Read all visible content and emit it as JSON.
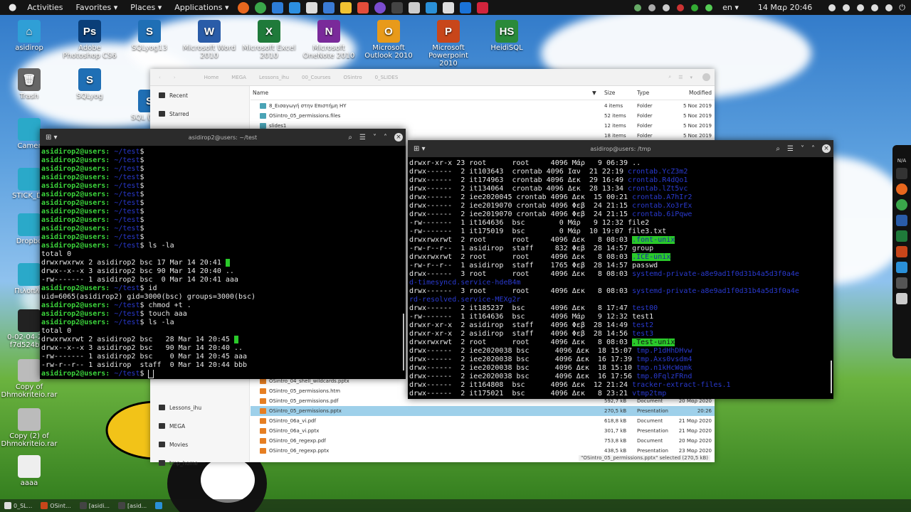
{
  "topbar": {
    "activities": "Activities",
    "favorites": "Favorites ▾",
    "places": "Places ▾",
    "applications": "Applications ▾",
    "language": "en ▾",
    "clock": "14 Μαρ 20:46"
  },
  "desktop_icons": [
    {
      "label": "asidirop",
      "color": "#2f9fd6",
      "glyph": "⌂"
    },
    {
      "label": "Adobe Photoshop CS6",
      "color": "#0a3e78",
      "glyph": "Ps"
    },
    {
      "label": "SQLyog13",
      "color": "#1f6fb5",
      "glyph": "S"
    },
    {
      "label": "Microsoft Word 2010",
      "color": "#2a5ca8",
      "glyph": "W"
    },
    {
      "label": "Microsoft Excel 2010",
      "color": "#1f7a3a",
      "glyph": "X"
    },
    {
      "label": "Microsoft OneNote 2010",
      "color": "#7a2a9a",
      "glyph": "N"
    },
    {
      "label": "Microsoft Outlook 2010",
      "color": "#e89a1a",
      "glyph": "O"
    },
    {
      "label": "Microsoft Powerpoint 2010",
      "color": "#c8461a",
      "glyph": "P"
    },
    {
      "label": "HeidiSQL",
      "color": "#2a8a3a",
      "glyph": "HS"
    },
    {
      "label": "Trash",
      "color": "#666",
      "glyph": "🗑"
    },
    {
      "label": "SQLyog",
      "color": "#1f6fb5",
      "glyph": "S"
    },
    {
      "label": "SQL (SQLy",
      "color": "#1f6fb5",
      "glyph": "S"
    },
    {
      "label": "Camer",
      "color": "#2aa9c9",
      "glyph": ""
    },
    {
      "label": "STICK_DE",
      "color": "#2aa9c9",
      "glyph": ""
    },
    {
      "label": "Dropbo",
      "color": "#2aa9c9",
      "glyph": ""
    },
    {
      "label": "Πιλοπλα",
      "color": "#2aa9c9",
      "glyph": ""
    },
    {
      "label": "0-02-04-288 f7d524b65",
      "color": "#222",
      "glyph": ""
    },
    {
      "label": "Copy of Dhmokriteio.rar",
      "color": "#bbb",
      "glyph": ""
    },
    {
      "label": "Copy (2) of Dhmokriteio.rar",
      "color": "#bbb",
      "glyph": ""
    },
    {
      "label": "aaaa",
      "color": "#eee",
      "glyph": ""
    }
  ],
  "file_manager": {
    "breadcrumb": [
      "Home",
      "MEGA",
      "Lessons_ihu",
      "00_Courses",
      "OSintro",
      "0_SLIDES"
    ],
    "sidebar": [
      "Recent",
      "Starred",
      "Lessons_ihu",
      "MEGA",
      "Movies",
      "tmp_home"
    ],
    "columns": {
      "name": "Name",
      "size": "Size",
      "type": "Type",
      "modified": "Modified"
    },
    "rows_top": [
      {
        "name": "8_Εισαγωγή στην Επιστήμη ΗΥ",
        "size": "4 items",
        "type": "Folder",
        "date": "5 Νοε 2019",
        "folder": true
      },
      {
        "name": "OSintro_05_permissions.files",
        "size": "52 items",
        "type": "Folder",
        "date": "5 Νοε 2019",
        "folder": true
      },
      {
        "name": "slides1",
        "size": "12 items",
        "type": "Folder",
        "date": "5 Νοε 2019",
        "folder": true
      },
      {
        "name": "",
        "size": "18 items",
        "type": "Folder",
        "date": "5 Νοε 2019",
        "folder": true
      }
    ],
    "rows_bottom": [
      {
        "name": "OSintro_04_shell_wildcards.pptx",
        "size": "",
        "type": "",
        "date": "",
        "folder": false
      },
      {
        "name": "OSintro_05_permissions.htm",
        "size": "",
        "type": "",
        "date": "",
        "folder": false
      },
      {
        "name": "OSintro_05_permissions.pdf",
        "size": "592,7 kB",
        "type": "Document",
        "date": "20 Μαρ 2020",
        "folder": false
      },
      {
        "name": "OSintro_05_permissions.pptx",
        "size": "270,5 kB",
        "type": "Presentation",
        "date": "20:26",
        "folder": false,
        "selected": true
      },
      {
        "name": "OSintro_06a_vi.pdf",
        "size": "618,8 kB",
        "type": "Document",
        "date": "21 Μαρ 2020",
        "folder": false
      },
      {
        "name": "OSintro_06a_vi.pptx",
        "size": "301,7 kB",
        "type": "Presentation",
        "date": "21 Μαρ 2020",
        "folder": false
      },
      {
        "name": "OSintro_06_regexp.pdf",
        "size": "753,8 kB",
        "type": "Document",
        "date": "20 Μαρ 2020",
        "folder": false
      },
      {
        "name": "OSintro_06_regexp.pptx",
        "size": "438,5 kB",
        "type": "Presentation",
        "date": "23 Μαρ 2020",
        "folder": false
      }
    ],
    "status": "\"OSintro_05_permissions.pptx\" selected  (270,5 kB)"
  },
  "term_left": {
    "title": "asidirop2@users: ~/test",
    "lines": [
      {
        "p": "asidirop2@users:",
        "path": " ~/test",
        "cmd": "$"
      },
      {
        "p": "asidirop2@users:",
        "path": " ~/test",
        "cmd": "$"
      },
      {
        "p": "asidirop2@users:",
        "path": " ~/test",
        "cmd": "$"
      },
      {
        "p": "asidirop2@users:",
        "path": " ~/test",
        "cmd": "$"
      },
      {
        "p": "asidirop2@users:",
        "path": " ~/test",
        "cmd": "$"
      },
      {
        "p": "asidirop2@users:",
        "path": " ~/test",
        "cmd": "$"
      },
      {
        "p": "asidirop2@users:",
        "path": " ~/test",
        "cmd": "$"
      },
      {
        "p": "asidirop2@users:",
        "path": " ~/test",
        "cmd": "$"
      },
      {
        "p": "asidirop2@users:",
        "path": " ~/test",
        "cmd": "$"
      },
      {
        "p": "asidirop2@users:",
        "path": " ~/test",
        "cmd": "$"
      },
      {
        "p": "asidirop2@users:",
        "path": " ~/test",
        "cmd": "$"
      },
      {
        "p": "asidirop2@users:",
        "path": " ~/test",
        "cmd": "$ ls -la"
      },
      {
        "t": "total 0"
      },
      {
        "t": "drwxrwxrwx 2 asidirop2 bsc 17 Mar 14 20:41 ",
        "box": true
      },
      {
        "t": "drwx--x--x 3 asidirop2 bsc 90 Mar 14 20:40 .."
      },
      {
        "t": "-rw------- 1 asidirop2 bsc  0 Mar 14 20:41 aaa"
      },
      {
        "p": "asidirop2@users:",
        "path": " ~/test",
        "cmd": "$ id"
      },
      {
        "t": "uid=6065(asidirop2) gid=3000(bsc) groups=3000(bsc)"
      },
      {
        "p": "asidirop2@users:",
        "path": " ~/test",
        "cmd": "$ chmod +t ."
      },
      {
        "p": "asidirop2@users:",
        "path": " ~/test",
        "cmd": "$ touch aaa"
      },
      {
        "p": "asidirop2@users:",
        "path": " ~/test",
        "cmd": "$ ls -la"
      },
      {
        "t": "total 0"
      },
      {
        "t": "drwxrwxrwt 2 asidirop2 bsc   28 Mar 14 20:45 ",
        "box": true
      },
      {
        "t": "drwx--x--x 3 asidirop2 bsc   90 Mar 14 20:40 .."
      },
      {
        "t": "-rw------- 1 asidirop2 bsc    0 Mar 14 20:45 aaa"
      },
      {
        "t": "-rw-r--r-- 1 asidirop  staff  0 Mar 14 20:44 bbb"
      },
      {
        "p": "asidirop2@users:",
        "path": " ~/test",
        "cmd": "$ ",
        "cursor": true
      }
    ]
  },
  "term_right": {
    "title": "asidirop@users: /tmp",
    "lines": [
      {
        "t": "drwxr-xr-x 23 root      root     4096 Μάρ   9 06:39 ",
        "name": ".."
      },
      {
        "t": "drwx------  2 it103643  crontab 4096 Ιαν  21 22:19 ",
        "name": "crontab.YcZ3m2",
        "c": "bl"
      },
      {
        "t": "drwx------  2 it174963  crontab 4096 Δεκ  29 16:49 ",
        "name": "crontab.R4dQo1",
        "c": "bl"
      },
      {
        "t": "drwx------  2 it134064  crontab 4096 Δεκ  28 13:34 ",
        "name": "crontab.lZt5vc",
        "c": "bl"
      },
      {
        "t": "drwx------  2 iee2020045 crontab 4096 Δεκ  15 00:21 ",
        "name": "crontab.A7hIr2",
        "c": "bl"
      },
      {
        "t": "drwx------  2 iee2019070 crontab 4096 Φεβ  24 21:15 ",
        "name": "crontab.Xo3rEx",
        "c": "bl"
      },
      {
        "t": "drwx------  2 iee2019070 crontab 4096 Φεβ  24 21:15 ",
        "name": "crontab.6iPqwe",
        "c": "bl"
      },
      {
        "t": "-rw-------  1 it164636  bsc        0 Μάρ   9 12:32 ",
        "name": "file2"
      },
      {
        "t": "-rw-------  1 it175019  bsc        0 Μάρ  10 19:07 ",
        "name": "file3.txt"
      },
      {
        "t": "drwxrwxrwt  2 root      root     4096 Δεκ   8 08:03 ",
        "name": ".font-unix",
        "c": "hl"
      },
      {
        "t": "-rw-r--r--  1 asidirop  staff     832 Φεβ  28 14:57 ",
        "name": "group"
      },
      {
        "t": "drwxrwxrwt  2 root      root     4096 Δεκ   8 08:03 ",
        "name": ".ICE-unix",
        "c": "hl"
      },
      {
        "t": "-rw-r--r--  1 asidirop  staff    1765 Φεβ  28 14:57 ",
        "name": "passwd"
      },
      {
        "t": "drwx------  3 root      root     4096 Δεκ   8 08:03 ",
        "name": "systemd-private-a8e9ad1f0d31b4a5d3f0a4e",
        "c": "bl"
      },
      {
        "t": "",
        "name": "d-timesyncd.service-hdeB4m",
        "c": "bl"
      },
      {
        "t": "drwx------  3 root      root     4096 Δεκ   8 08:03 ",
        "name": "systemd-private-a8e9ad1f0d31b4a5d3f0a4e",
        "c": "bl"
      },
      {
        "t": "",
        "name": "rd-resolved.service-MEXg2r",
        "c": "bl"
      },
      {
        "t": "drwx------  2 it185237  bsc      4096 Δεκ   8 17:47 ",
        "name": "test00",
        "c": "bl"
      },
      {
        "t": "-rw-------  1 it164636  bsc      4096 Μάρ   9 12:32 ",
        "name": "test1"
      },
      {
        "t": "drwxr-xr-x  2 asidirop  staff    4096 Φεβ  28 14:49 ",
        "name": "test2",
        "c": "bl"
      },
      {
        "t": "drwxr-xr-x  2 asidirop  staff    4096 Φεβ  28 14:56 ",
        "name": "test3",
        "c": "bl"
      },
      {
        "t": "drwxrwxrwt  2 root      root     4096 Δεκ   8 08:03 ",
        "name": ".Test-unix",
        "c": "hl2"
      },
      {
        "t": "drwx------  2 iee2020038 bsc      4096 Δεκ  18 15:07 ",
        "name": "tmp.P1dHhDHvw",
        "c": "bl"
      },
      {
        "t": "drwx------  2 iee2020038 bsc      4096 Δεκ  16 17:39 ",
        "name": "tmp.Axs0vsdm4",
        "c": "bl"
      },
      {
        "t": "drwx------  2 iee2020038 bsc      4096 Δεκ  18 15:10 ",
        "name": "tmp.n1kHcWqmk",
        "c": "bl"
      },
      {
        "t": "drwx------  2 iee2020038 bsc      4096 Δεκ  16 17:56 ",
        "name": "tmp.0FqlzFRnd",
        "c": "bl"
      },
      {
        "t": "drwx------  2 it164808  bsc      4096 Δεκ  12 21:24 ",
        "name": "tracker-extract-files.1",
        "c": "bl"
      },
      {
        "t": "drwx------  2 it175021  bsc      4096 Δεκ   8 23:21 ",
        "name": "vtmp2tmp",
        "c": "bl"
      }
    ]
  },
  "taskbar": [
    "0_SL...",
    "OSint...",
    "[asidi...",
    "[asid...",
    ""
  ]
}
